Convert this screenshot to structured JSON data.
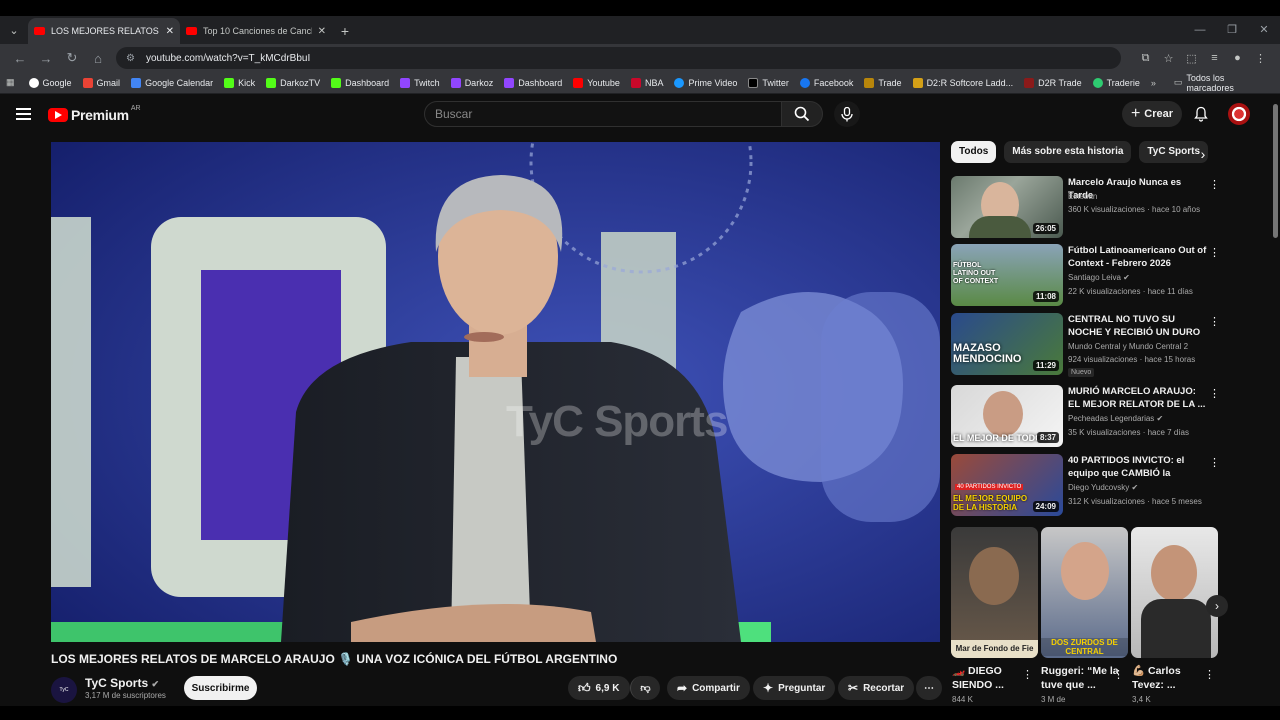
{
  "tabs": [
    {
      "title": "LOS MEJORES RELATOS DE MA"
    },
    {
      "title": "Top 10 Canciones de Cancha M"
    }
  ],
  "address": {
    "url": "youtube.com/watch?v=T_kMCdrBbuI"
  },
  "bookmarks": [
    "Google",
    "Gmail",
    "Google Calendar",
    "Kick",
    "DarkozTV",
    "Dashboard",
    "Twitch",
    "Darkoz",
    "Dashboard",
    "Youtube",
    "NBA",
    "Prime Video",
    "Twitter",
    "Facebook",
    "Trade",
    "D2:R Softcore Ladd...",
    "D2R Trade",
    "Traderie"
  ],
  "bookmarks_all": "Todos los marcadores",
  "header": {
    "brand": "Premium",
    "region": "AR",
    "search_placeholder": "Buscar",
    "create_label": "Crear"
  },
  "video": {
    "watermark": "TyC Sports",
    "title": "LOS MEJORES RELATOS DE MARCELO ARAUJO 🎙️ UNA VOZ ICÓNICA DEL FÚTBOL ARGENTINO",
    "channel": "TyC Sports",
    "subscribers": "3,17 M de suscriptores",
    "subscribe_label": "Suscribirme",
    "likes": "6,9 K",
    "share_label": "Compartir",
    "ask_label": "Preguntar",
    "clip_label": "Recortar"
  },
  "chips": [
    "Todos",
    "Más sobre esta historia",
    "TyC Sports"
  ],
  "recommendations": [
    {
      "title": "Marcelo Araujo Nunca es Tarde",
      "channel": "Esteban",
      "meta": "360 K visualizaciones · hace 10 años",
      "duration": "26:05",
      "verified": false,
      "badge": ""
    },
    {
      "title": "Fútbol Latinoamericano Out of Context - Febrero 2026",
      "channel": "Santiago Leiva",
      "meta": "22 K visualizaciones · hace 11 días",
      "duration": "11:08",
      "verified": true,
      "badge": ""
    },
    {
      "title": "CENTRAL NO TUVO SU NOCHE Y RECIBIÓ UN DURO MASAZO ...",
      "channel": "Mundo Central y Mundo Central 2",
      "meta": "924 visualizaciones · hace 15 horas",
      "duration": "11:29",
      "verified": false,
      "badge": "Nuevo"
    },
    {
      "title": "MURIÓ MARCELO ARAUJO: EL MEJOR RELATOR DE LA ...",
      "channel": "Pecheadas Legendarias",
      "meta": "35 K visualizaciones · hace 7 días",
      "duration": "8:37",
      "verified": true,
      "badge": ""
    },
    {
      "title": "40 PARTIDOS INVICTO: el equipo que CAMBIÓ la Histori...",
      "channel": "Diego Yudcovsky",
      "meta": "312 K visualizaciones · hace 5 meses",
      "duration": "24:09",
      "verified": true,
      "badge": ""
    }
  ],
  "thumb_texts": {
    "r2": "FÚTBOL LATINO OUT OF CONTEXT",
    "r3": "MAZASO MENDOCINO",
    "r4": "EL MEJOR DE TODOS",
    "r5a": "40 PARTIDOS INVICTO",
    "r5b": "EL MEJOR EQUIPO DE LA HISTORIA"
  },
  "shorts": [
    {
      "title": "🏎️ DIEGO SIENDO ...",
      "views": "844 K",
      "caption": "Mar de Fondo de Fie"
    },
    {
      "title": "Ruggeri: “Me la tuve que ...",
      "views": "3 M de",
      "caption": "DOS ZURDOS DE CENTRAL"
    },
    {
      "title": "💪🏼 Carlos Tevez: ...",
      "views": "3,4 K",
      "caption": ""
    }
  ]
}
